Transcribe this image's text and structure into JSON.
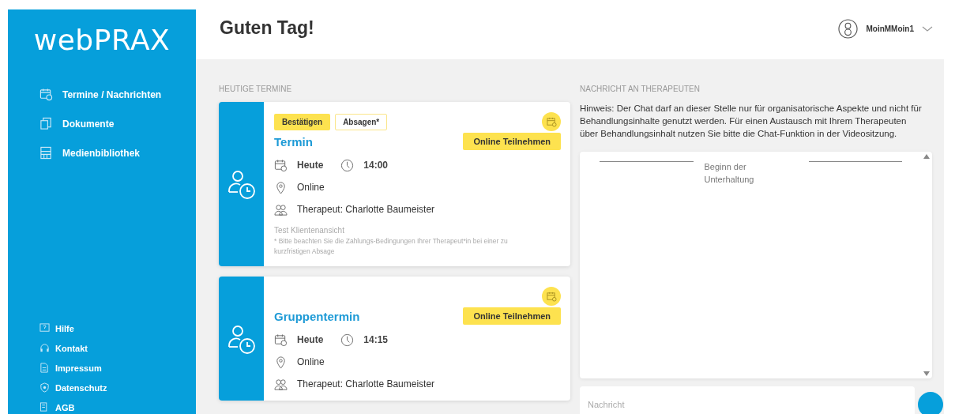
{
  "sidebar": {
    "logo": "webPRAX",
    "nav": [
      {
        "kind": "calendar",
        "label": "Termine / Nachrichten"
      },
      {
        "kind": "document",
        "label": "Dokumente"
      },
      {
        "kind": "media",
        "label": "Medienbibliothek"
      }
    ],
    "footer_links": [
      {
        "kind": "help",
        "label": "Hilfe"
      },
      {
        "kind": "contact",
        "label": "Kontakt"
      },
      {
        "kind": "imprint",
        "label": "Impressum"
      },
      {
        "kind": "privacy",
        "label": "Datenschutz"
      },
      {
        "kind": "terms",
        "label": "AGB"
      }
    ]
  },
  "header": {
    "greeting": "Guten Tag!",
    "user": "MoinMMoin1"
  },
  "appointments": {
    "heading": "HEUTIGE TERMINE",
    "items": [
      {
        "actions": [
          {
            "kind": "primary",
            "label": "Bestätigen"
          },
          {
            "kind": "outline",
            "label": "Absagen*"
          }
        ],
        "title": "Termin",
        "join": "Online Teilnehmen",
        "date": "Heute",
        "time": "14:00",
        "location": "Online",
        "therapist": "Therapeut: Charlotte Baumeister",
        "note": "Test Klientenansicht",
        "footnote": "* Bitte beachten Sie die Zahlungs-Bedingungen Ihrer Therapeut*in bei einer zu kurzfristigen Absage"
      },
      {
        "title": "Gruppentermin",
        "join": "Online Teilnehmen",
        "date": "Heute",
        "time": "14:15",
        "location": "Online",
        "therapist": "Therapeut: Charlotte Baumeister"
      }
    ]
  },
  "chat": {
    "heading": "NACHRICHT AN THERAPEUTEN",
    "notice": "Hinweis: Der Chat darf an dieser Stelle nur für organisatorische Aspekte und nicht für Behandlungsinhalte genutzt werden. Für einen Austausch mit Ihrem Therapeuten über Behandlungsinhalt nutzen Sie bitte die Chat-Funktion in der Videositzung.",
    "divider": "Beginn der Unterhaltung",
    "input": {
      "placeholder": "Nachricht"
    }
  }
}
